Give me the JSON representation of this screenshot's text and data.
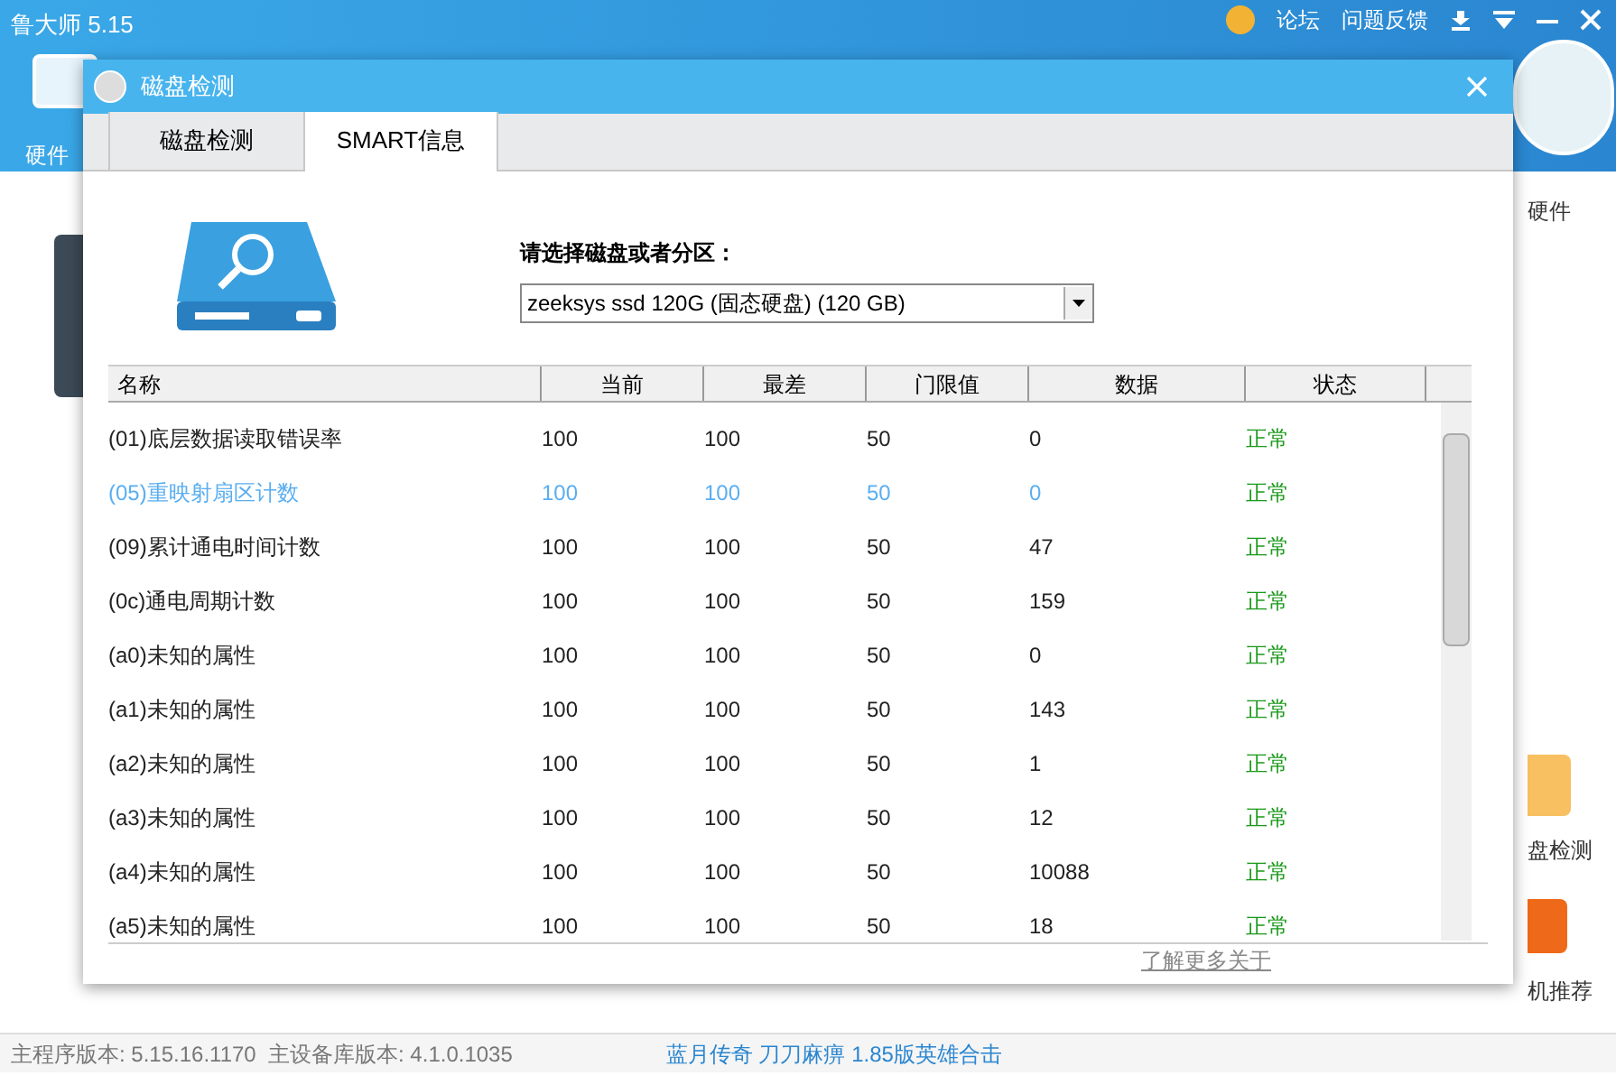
{
  "app": {
    "title": "鲁大师 5.15",
    "links": [
      "论坛",
      "问题反馈"
    ],
    "left_label": "硬件",
    "right_labels": [
      "硬件",
      "盘检测",
      "机推荐"
    ]
  },
  "dialog": {
    "title": "磁盘检测",
    "tabs": [
      {
        "label": "磁盘检测",
        "selected": false
      },
      {
        "label": "SMART信息",
        "selected": true
      }
    ],
    "disk_label": "请选择磁盘或者分区：",
    "disk_value": "zeeksys ssd 120G (固态硬盘)  (120 GB)",
    "table": {
      "columns": [
        "名称",
        "当前",
        "最差",
        "门限值",
        "数据",
        "状态"
      ],
      "rows": [
        {
          "cells": [
            "(01)底层数据读取错误率",
            "100",
            "100",
            "50",
            "0",
            "正常"
          ],
          "selected": false
        },
        {
          "cells": [
            "(05)重映射扇区计数",
            "100",
            "100",
            "50",
            "0",
            "正常"
          ],
          "selected": true
        },
        {
          "cells": [
            "(09)累计通电时间计数",
            "100",
            "100",
            "50",
            "47",
            "正常"
          ],
          "selected": false
        },
        {
          "cells": [
            "(0c)通电周期计数",
            "100",
            "100",
            "50",
            "159",
            "正常"
          ],
          "selected": false
        },
        {
          "cells": [
            "(a0)未知的属性",
            "100",
            "100",
            "50",
            "0",
            "正常"
          ],
          "selected": false
        },
        {
          "cells": [
            "(a1)未知的属性",
            "100",
            "100",
            "50",
            "143",
            "正常"
          ],
          "selected": false
        },
        {
          "cells": [
            "(a2)未知的属性",
            "100",
            "100",
            "50",
            "1",
            "正常"
          ],
          "selected": false
        },
        {
          "cells": [
            "(a3)未知的属性",
            "100",
            "100",
            "50",
            "12",
            "正常"
          ],
          "selected": false
        },
        {
          "cells": [
            "(a4)未知的属性",
            "100",
            "100",
            "50",
            "10088",
            "正常"
          ],
          "selected": false
        },
        {
          "cells": [
            "(a5)未知的属性",
            "100",
            "100",
            "50",
            "18",
            "正常"
          ],
          "selected": false
        }
      ]
    },
    "footer_link": "了解更多关于"
  },
  "status_bar": {
    "versions": "主程序版本: 5.15.16.1170  主设备库版本: 4.1.0.1035",
    "promo": "蓝月传奇 刀刀麻痹 1.85版英雄合击"
  }
}
